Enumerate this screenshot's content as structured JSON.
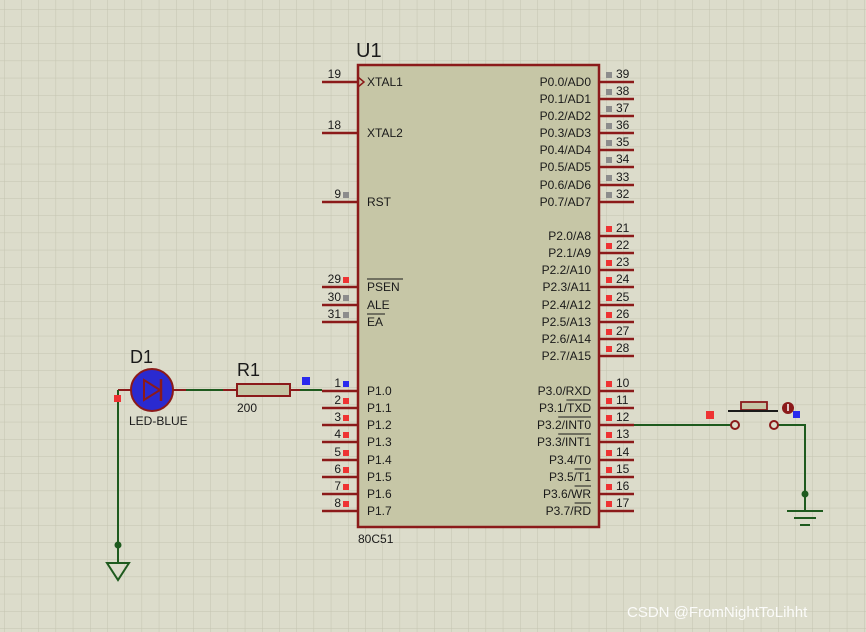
{
  "colors": {
    "background": "#dcdccb",
    "grid": "#c4c4b0",
    "chip_fill": "#c6c6a6",
    "component_stroke": "#8b1a1a",
    "pin_stroke": "#8b1a1a",
    "wire": "#1e5a1e",
    "junction": "#1e5a1e",
    "label_text": "#1a1a1a",
    "pin_marker_red": "#ee3333",
    "pin_marker_gray": "#8c8c8c",
    "pin_marker_blue": "#2a2aee",
    "led_fill": "#2a2ad0",
    "led_ring": "#8b1a1a",
    "watermark": "#ffffff"
  },
  "chip": {
    "ref": "U1",
    "part": "80C51",
    "left_pins": [
      {
        "num": "19",
        "name": "XTAL1",
        "clock": true,
        "marker": "none"
      },
      {
        "num": "18",
        "name": "XTAL2",
        "marker": "none"
      },
      {
        "num": "9",
        "name": "RST",
        "marker": "gray"
      },
      {
        "num": "29",
        "name": "PSEN",
        "overbar": true,
        "marker": "red"
      },
      {
        "num": "30",
        "name": "ALE",
        "marker": "gray"
      },
      {
        "num": "31",
        "name": "EA",
        "overbar": true,
        "marker": "gray"
      },
      {
        "num": "1",
        "name": "P1.0",
        "marker": "blue"
      },
      {
        "num": "2",
        "name": "P1.1",
        "marker": "red"
      },
      {
        "num": "3",
        "name": "P1.2",
        "marker": "red"
      },
      {
        "num": "4",
        "name": "P1.3",
        "marker": "red"
      },
      {
        "num": "5",
        "name": "P1.4",
        "marker": "red"
      },
      {
        "num": "6",
        "name": "P1.5",
        "marker": "red"
      },
      {
        "num": "7",
        "name": "P1.6",
        "marker": "red"
      },
      {
        "num": "8",
        "name": "P1.7",
        "marker": "red"
      }
    ],
    "right_pins": [
      {
        "num": "39",
        "name": "P0.0/AD0",
        "marker": "gray"
      },
      {
        "num": "38",
        "name": "P0.1/AD1",
        "marker": "gray"
      },
      {
        "num": "37",
        "name": "P0.2/AD2",
        "marker": "gray"
      },
      {
        "num": "36",
        "name": "P0.3/AD3",
        "marker": "gray"
      },
      {
        "num": "35",
        "name": "P0.4/AD4",
        "marker": "gray"
      },
      {
        "num": "34",
        "name": "P0.5/AD5",
        "marker": "gray"
      },
      {
        "num": "33",
        "name": "P0.6/AD6",
        "marker": "gray"
      },
      {
        "num": "32",
        "name": "P0.7/AD7",
        "marker": "gray"
      },
      {
        "num": "21",
        "name": "P2.0/A8",
        "marker": "red"
      },
      {
        "num": "22",
        "name": "P2.1/A9",
        "marker": "red"
      },
      {
        "num": "23",
        "name": "P2.2/A10",
        "marker": "red"
      },
      {
        "num": "24",
        "name": "P2.3/A11",
        "marker": "red"
      },
      {
        "num": "25",
        "name": "P2.4/A12",
        "marker": "red"
      },
      {
        "num": "26",
        "name": "P2.5/A13",
        "marker": "red"
      },
      {
        "num": "27",
        "name": "P2.6/A14",
        "marker": "red"
      },
      {
        "num": "28",
        "name": "P2.7/A15",
        "marker": "red"
      },
      {
        "num": "10",
        "name": "P3.0/RXD",
        "marker": "red"
      },
      {
        "num": "11",
        "name": "P3.1/",
        "bar_part": "TXD",
        "marker": "red"
      },
      {
        "num": "12",
        "name": "P3.2/",
        "bar_part": "INT0",
        "marker": "red"
      },
      {
        "num": "13",
        "name": "P3.3/",
        "bar_part": "INT1",
        "marker": "red"
      },
      {
        "num": "14",
        "name": "P3.4/T0",
        "marker": "red"
      },
      {
        "num": "15",
        "name": "P3.5/",
        "bar_part": "T1",
        "marker": "red"
      },
      {
        "num": "16",
        "name": "P3.6/",
        "bar_part": "WR",
        "marker": "red"
      },
      {
        "num": "17",
        "name": "P3.7/",
        "bar_part": "RD",
        "marker": "red"
      }
    ]
  },
  "led": {
    "ref": "D1",
    "value": "LED-BLUE"
  },
  "resistor": {
    "ref": "R1",
    "value": "200"
  },
  "watermark": "CSDN @FromNightToLihht"
}
